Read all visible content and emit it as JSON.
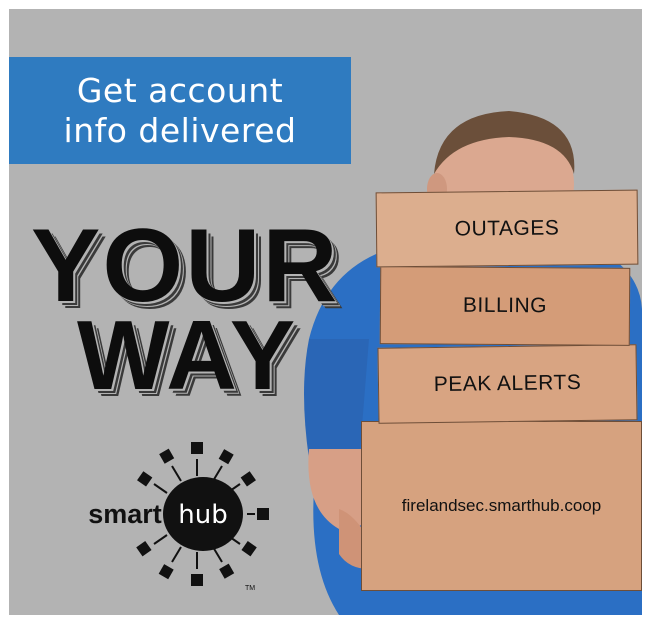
{
  "banner": {
    "line1": "Get account",
    "line2": "info delivered"
  },
  "headline": {
    "line1": "YOUR",
    "line2": "WAY"
  },
  "boxes": {
    "outages": "OUTAGES",
    "billing": "BILLING",
    "peak_alerts": "PEAK ALERTS",
    "url": "firelandsec.smarthub.coop"
  },
  "logo": {
    "word_left": "smart",
    "word_right": "hub",
    "trademark": "TM"
  },
  "colors": {
    "background": "#b3b3b3",
    "banner": "#2f7bc0",
    "box": "#d6a27f",
    "shirt": "#2b6fc4"
  }
}
